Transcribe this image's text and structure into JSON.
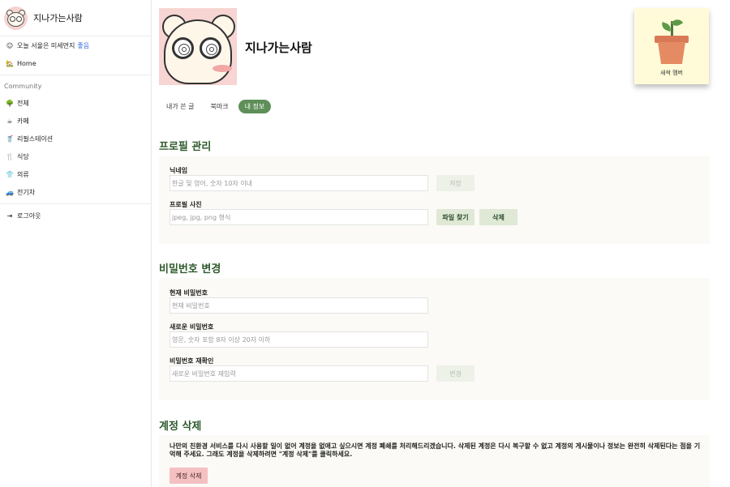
{
  "sidebar": {
    "title": "지나가는사람",
    "dust": {
      "prefix": "오늘 서울은 미세먼지",
      "status": "좋음"
    },
    "home": "Home",
    "section_label": "Community",
    "items": [
      {
        "icon": "tree-icon",
        "glyph": "🌳",
        "label": "전체"
      },
      {
        "icon": "coffee-icon",
        "glyph": "☕",
        "label": "카페"
      },
      {
        "icon": "cup-icon",
        "glyph": "🥤",
        "label": "리필스테이션"
      },
      {
        "icon": "utensils-icon",
        "glyph": "🍴",
        "label": "식당"
      },
      {
        "icon": "shirt-icon",
        "glyph": "👕",
        "label": "의류"
      },
      {
        "icon": "car-icon",
        "glyph": "🚙",
        "label": "전기차"
      }
    ],
    "logout": "로그아웃"
  },
  "profile": {
    "name": "지나가는사람",
    "badge_label": "새싹 멤버"
  },
  "tabs": [
    {
      "label": "내가 쓴 글",
      "active": false
    },
    {
      "label": "북마크",
      "active": false
    },
    {
      "label": "내 정보",
      "active": true
    }
  ],
  "profile_mgmt": {
    "title": "프로필 관리",
    "nickname_label": "닉네임",
    "nickname_placeholder": "한글 및 영어, 숫자 10자 이내",
    "save_button": "저장",
    "photo_label": "프로필 사진",
    "photo_placeholder": "jpeg, jpg, png 형식",
    "find_file_button": "파일 찾기",
    "delete_photo_button": "삭제"
  },
  "password": {
    "title": "비밀번호 변경",
    "current_label": "현재 비밀번호",
    "current_placeholder": "현재 비밀번호",
    "new_label": "새로운 비밀번호",
    "new_placeholder": "영문, 숫자 포함 8자 이상 20자 이하",
    "confirm_label": "비밀번호 재확인",
    "confirm_placeholder": "새로운 비밀번호 재입력",
    "change_button": "변경"
  },
  "account_delete": {
    "title": "계정 삭제",
    "description": "나만의 친환경 서비스를 다시 사용할 일이 없어 계정을 없애고 싶으시면 계정 폐쇄를 처리해드리겠습니다. 삭제된 계정은 다시 복구할 수 없고 계정의 게시물이나 정보는 완전히 삭제된다는 점을 기억해 주세요. 그래도 계정을 삭제하려면 \"계정 삭제\"를 클릭하세요.",
    "button": "계정 삭제"
  },
  "colors": {
    "accent_green": "#5e8f58",
    "section_title": "#2f5a2c",
    "dust_good": "#2b64e0",
    "danger": "#f5c0c2"
  }
}
